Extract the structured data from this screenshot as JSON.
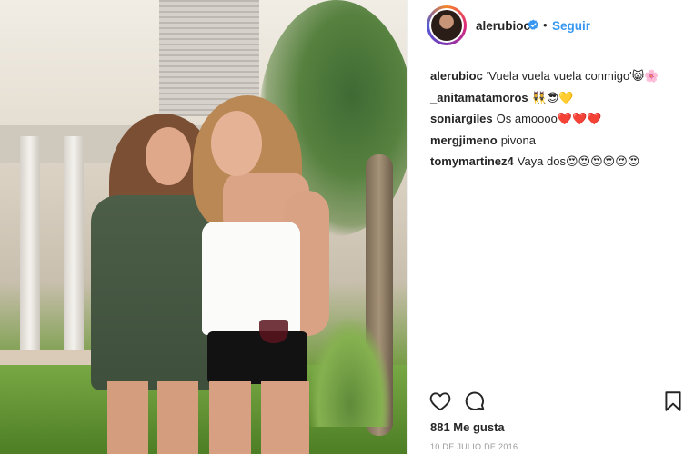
{
  "photo": {
    "alt": ""
  },
  "header": {
    "username": "alerubioc",
    "dot": "•",
    "follow_label": "Seguir"
  },
  "comments": [
    {
      "user": "alerubioc",
      "text": "'Vuela vuela vuela conmigo'😸🌸"
    },
    {
      "user": "_anitamatamoros",
      "text": "👯😎💛"
    },
    {
      "user": "soniargiles",
      "text": "Os amoooo❤️❤️❤️"
    },
    {
      "user": "mergjimeno",
      "text": "pivona"
    },
    {
      "user": "tomymartinez4",
      "text": "Vaya dos😍😍😍😍😍😍"
    }
  ],
  "actions": {
    "likes": "881 Me gusta",
    "date": "10 DE JULIO DE 2016"
  },
  "colors": {
    "link_blue": "#3897f0",
    "text": "#262626",
    "muted": "#999999",
    "divider": "#efefef"
  },
  "icons": [
    "verified-badge-icon",
    "heart-icon",
    "comment-icon",
    "bookmark-icon"
  ]
}
